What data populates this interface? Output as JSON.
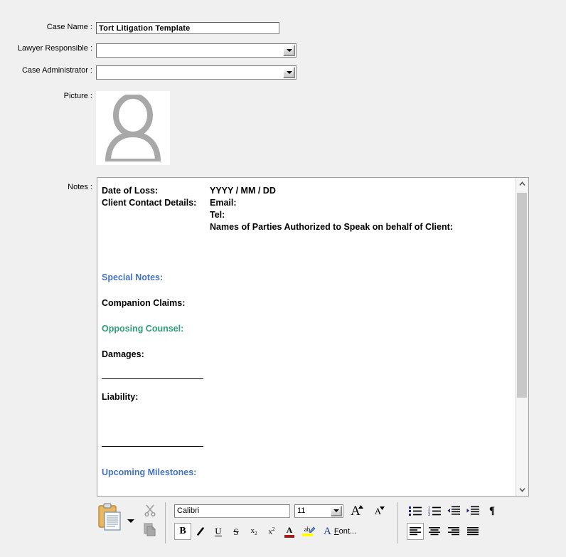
{
  "form": {
    "fields": [
      {
        "label": "Case Name :",
        "value": "Tort Litigation Template",
        "type": "text"
      },
      {
        "label": "Lawyer Responsible :",
        "value": "",
        "type": "combo"
      },
      {
        "label": "Case Administrator :",
        "value": "",
        "type": "combo"
      },
      {
        "label": "Picture :",
        "value": "",
        "type": "picture"
      },
      {
        "label": "Notes :",
        "value": "",
        "type": "richtext"
      }
    ]
  },
  "notes": {
    "rows": [
      {
        "left": "Date of Loss:",
        "right": "YYYY / MM / DD"
      },
      {
        "left": "Client Contact Details:",
        "right": "Email:"
      },
      {
        "left": "",
        "right": "Tel:"
      },
      {
        "left": "",
        "right": "Names of Parties Authorized to Speak on behalf of Client:"
      }
    ],
    "headings": {
      "special_notes": "Special Notes:",
      "companion_claims": "Companion Claims:",
      "opposing_counsel": "Opposing Counsel:",
      "damages": "Damages:",
      "liability": "Liability:",
      "upcoming_milestones": "Upcoming Milestones:"
    },
    "colors": {
      "blue": "#4472C4",
      "green": "#2E9E79",
      "black": "#000000"
    }
  },
  "toolbar": {
    "paste_label": "Paste",
    "cut_label": "Cut",
    "copy_label": "Copy",
    "font_name": "Calibri",
    "font_size": "11",
    "grow_font_label": "Grow Font",
    "shrink_font_label": "Shrink Font",
    "bold_label": "B",
    "italic_label": "I",
    "underline_label": "U",
    "strikethrough_label": "S",
    "subscript_label": "x",
    "subscript_sub": "2",
    "superscript_label": "x",
    "superscript_sup": "2",
    "font_color_label": "A",
    "highlight_label": "ab",
    "font_dialog_a": "A",
    "font_dialog_label_pre": "F",
    "font_dialog_label_post": "ont...",
    "bullets_label": "Bullets",
    "numbering_label": "Numbering",
    "decrease_indent_label": "Decrease Indent",
    "increase_indent_label": "Increase Indent",
    "pilcrow_label": "¶",
    "align_left_label": "Align Left",
    "align_center_label": "Center",
    "align_right_label": "Align Right",
    "justify_label": "Justify",
    "colors": {
      "font_color_swatch": "#A02020",
      "highlight_swatch": "#FFFF00",
      "clipboard_body": "#E8B860",
      "icon_navy": "#1F1F7A"
    }
  },
  "scrollbar": {
    "up_arrow": "∧",
    "down_arrow": "∨"
  }
}
